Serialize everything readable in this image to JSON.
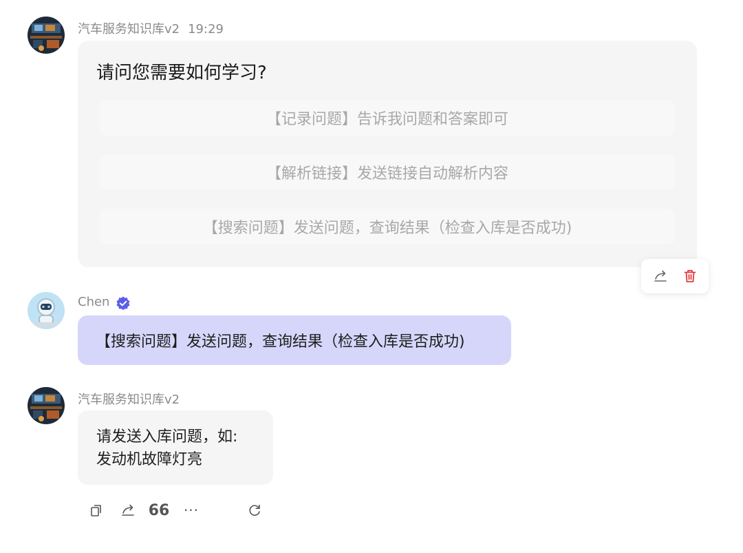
{
  "messages": [
    {
      "sender": "汽车服务知识库v2",
      "time": "19:29",
      "question": "请问您需要如何学习?",
      "options": [
        "【记录问题】告诉我问题和答案即可",
        "【解析链接】发送链接自动解析内容",
        "【搜索问题】发送问题，查询结果（检查入库是否成功)"
      ],
      "actions": [
        "share-icon",
        "trash-icon"
      ]
    },
    {
      "sender": "Chen",
      "verified": true,
      "text": "【搜索问题】发送问题，查询结果（检查入库是否成功)"
    },
    {
      "sender": "汽车服务知识库v2",
      "lines": [
        "请发送入库问题，如:",
        "发动机故障灯亮"
      ]
    }
  ],
  "toolbar": {
    "icons": [
      "copy-icon",
      "share-icon",
      "quote-icon",
      "more-icon",
      "refresh-icon"
    ],
    "quote_glyph": "66",
    "more_glyph": "···"
  },
  "colors": {
    "accent": "#5b5fe8",
    "user_bubble": "#d6d6fb",
    "delete": "#e03b3b"
  }
}
